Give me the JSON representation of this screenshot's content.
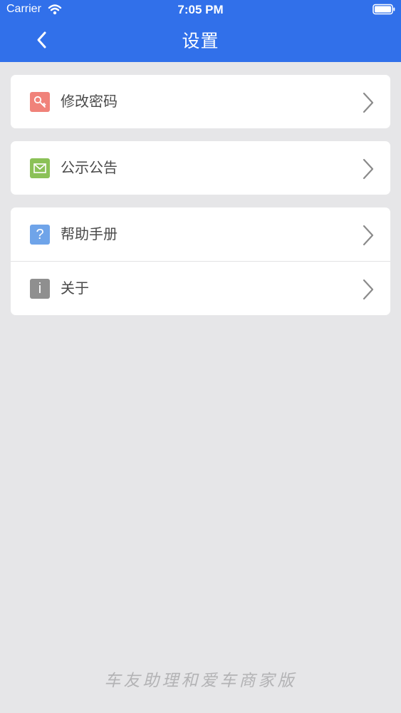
{
  "status_bar": {
    "carrier": "Carrier",
    "time": "7:05 PM"
  },
  "nav": {
    "title": "设置",
    "back_icon": "chevron-left-icon"
  },
  "groups": [
    {
      "items": [
        {
          "label": "修改密码",
          "icon": "key-icon",
          "icon_color": "#f0827a"
        }
      ]
    },
    {
      "items": [
        {
          "label": "公示公告",
          "icon": "mail-icon",
          "icon_color": "#8bc157"
        }
      ]
    },
    {
      "items": [
        {
          "label": "帮助手册",
          "icon": "question-icon",
          "icon_color": "#6fa4e9",
          "icon_glyph": "?"
        },
        {
          "label": "关于",
          "icon": "info-icon",
          "icon_color": "#8f8f8f",
          "icon_glyph": "i"
        }
      ]
    }
  ],
  "footer": {
    "signature": "车友助理和爱车商家版"
  },
  "colors": {
    "nav_bg": "#3170ea",
    "page_bg": "#e6e6e8",
    "chevron": "#8a8a8a"
  }
}
